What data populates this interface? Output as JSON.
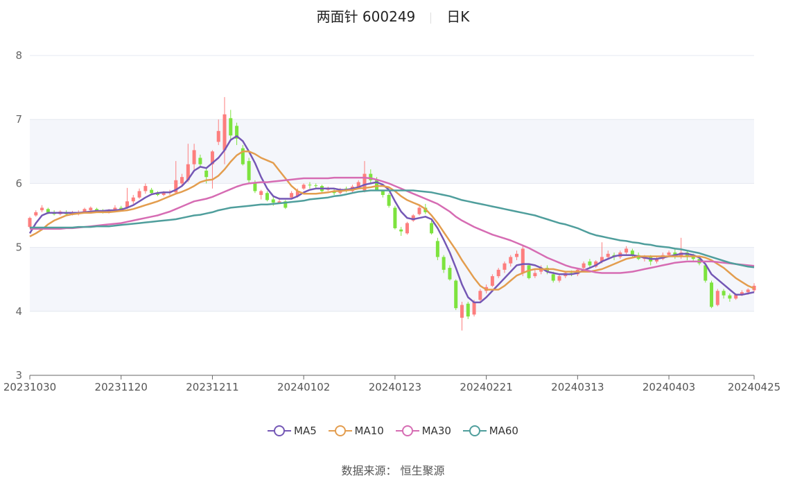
{
  "header": {
    "stock_name_code": "两面针 600249",
    "period": "日K"
  },
  "source_text": "数据来源： 恒生聚源",
  "colors": {
    "up": "#fd7e7e",
    "down": "#7de33e",
    "band": "#f4f6fb",
    "grid": "#e4e8f0",
    "MA5": "#7457b5",
    "MA10": "#e39d4e",
    "MA30": "#d66cb3",
    "MA60": "#4f9e9c"
  },
  "legend": [
    {
      "name": "MA5",
      "color": "#7457b5"
    },
    {
      "name": "MA10",
      "color": "#e39d4e"
    },
    {
      "name": "MA30",
      "color": "#d66cb3"
    },
    {
      "name": "MA60",
      "color": "#4f9e9c"
    }
  ],
  "chart_data": {
    "type": "candlestick",
    "ylim": [
      3,
      8
    ],
    "y_ticks": [
      3,
      4,
      5,
      6,
      7,
      8
    ],
    "x_tick_labels": [
      "20231030",
      "20231120",
      "20231211",
      "20240102",
      "20240123",
      "20240221",
      "20240313",
      "20240403",
      "20240425"
    ],
    "x_tick_index": [
      0,
      15,
      30,
      45,
      60,
      75,
      90,
      105,
      119
    ],
    "candles": [
      [
        5.32,
        5.46,
        5.48,
        5.3
      ],
      [
        5.5,
        5.55,
        5.58,
        5.48
      ],
      [
        5.58,
        5.62,
        5.66,
        5.55
      ],
      [
        5.6,
        5.55,
        5.62,
        5.52
      ],
      [
        5.55,
        5.52,
        5.58,
        5.5
      ],
      [
        5.52,
        5.56,
        5.58,
        5.5
      ],
      [
        5.55,
        5.52,
        5.58,
        5.5
      ],
      [
        5.52,
        5.54,
        5.57,
        5.5
      ],
      [
        5.52,
        5.55,
        5.58,
        5.5
      ],
      [
        5.55,
        5.6,
        5.62,
        5.53
      ],
      [
        5.58,
        5.62,
        5.64,
        5.55
      ],
      [
        5.6,
        5.57,
        5.62,
        5.55
      ],
      [
        5.57,
        5.55,
        5.6,
        5.53
      ],
      [
        5.55,
        5.58,
        5.6,
        5.53
      ],
      [
        5.58,
        5.62,
        5.66,
        5.56
      ],
      [
        5.62,
        5.58,
        5.65,
        5.56
      ],
      [
        5.62,
        5.72,
        5.93,
        5.6
      ],
      [
        5.72,
        5.78,
        5.82,
        5.68
      ],
      [
        5.78,
        5.88,
        5.92,
        5.76
      ],
      [
        5.88,
        5.96,
        6.0,
        5.84
      ],
      [
        5.9,
        5.85,
        5.93,
        5.82
      ],
      [
        5.85,
        5.82,
        5.88,
        5.8
      ],
      [
        5.82,
        5.85,
        5.88,
        5.8
      ],
      [
        5.85,
        5.86,
        5.9,
        5.82
      ],
      [
        5.86,
        6.05,
        6.35,
        5.84
      ],
      [
        6.0,
        6.1,
        6.15,
        5.95
      ],
      [
        6.05,
        6.3,
        6.62,
        6.02
      ],
      [
        6.3,
        6.52,
        6.62,
        6.2
      ],
      [
        6.4,
        6.3,
        6.45,
        6.25
      ],
      [
        6.2,
        6.1,
        6.25,
        6.0
      ],
      [
        6.3,
        6.5,
        6.52,
        5.92
      ],
      [
        6.65,
        6.82,
        7.0,
        6.6
      ],
      [
        6.52,
        7.08,
        7.35,
        6.3
      ],
      [
        7.02,
        6.75,
        7.15,
        6.68
      ],
      [
        6.9,
        6.7,
        6.95,
        6.6
      ],
      [
        6.55,
        6.3,
        6.6,
        6.28
      ],
      [
        6.35,
        6.05,
        6.4,
        6.0
      ],
      [
        6.0,
        5.88,
        6.05,
        5.85
      ],
      [
        5.82,
        5.88,
        5.9,
        5.75
      ],
      [
        5.85,
        5.74,
        5.88,
        5.72
      ],
      [
        5.75,
        5.7,
        5.8,
        5.65
      ],
      [
        5.7,
        5.72,
        5.78,
        5.68
      ],
      [
        5.72,
        5.62,
        5.74,
        5.6
      ],
      [
        5.78,
        5.85,
        5.88,
        5.75
      ],
      [
        5.8,
        5.88,
        5.92,
        5.78
      ],
      [
        5.92,
        5.98,
        6.0,
        5.9
      ],
      [
        5.98,
        5.97,
        6.02,
        5.92
      ],
      [
        5.97,
        5.96,
        6.0,
        5.92
      ],
      [
        5.96,
        5.88,
        5.98,
        5.85
      ],
      [
        5.9,
        5.92,
        5.95,
        5.88
      ],
      [
        5.88,
        5.85,
        5.92,
        5.82
      ],
      [
        5.85,
        5.9,
        5.93,
        5.83
      ],
      [
        5.92,
        5.88,
        5.95,
        5.86
      ],
      [
        5.88,
        5.95,
        5.98,
        5.85
      ],
      [
        5.95,
        6.02,
        6.05,
        5.92
      ],
      [
        5.88,
        6.15,
        6.35,
        5.86
      ],
      [
        6.15,
        6.05,
        6.22,
        6.0
      ],
      [
        6.05,
        5.9,
        6.1,
        5.88
      ],
      [
        5.88,
        5.82,
        5.9,
        5.78
      ],
      [
        5.82,
        5.65,
        5.85,
        5.62
      ],
      [
        5.62,
        5.3,
        5.65,
        5.28
      ],
      [
        5.28,
        5.25,
        5.32,
        5.18
      ],
      [
        5.22,
        5.38,
        5.4,
        5.2
      ],
      [
        5.42,
        5.5,
        5.52,
        5.4
      ],
      [
        5.52,
        5.62,
        5.66,
        5.5
      ],
      [
        5.62,
        5.55,
        5.68,
        5.52
      ],
      [
        5.38,
        5.22,
        5.42,
        5.2
      ],
      [
        5.1,
        4.85,
        5.15,
        4.8
      ],
      [
        4.85,
        4.65,
        4.88,
        4.6
      ],
      [
        4.68,
        4.5,
        4.72,
        4.48
      ],
      [
        4.48,
        4.05,
        4.5,
        4.02
      ],
      [
        3.9,
        4.1,
        4.15,
        3.7
      ],
      [
        4.12,
        3.92,
        4.15,
        3.88
      ],
      [
        3.95,
        4.15,
        4.18,
        3.92
      ],
      [
        4.18,
        4.32,
        4.35,
        4.15
      ],
      [
        4.32,
        4.38,
        4.42,
        4.28
      ],
      [
        4.4,
        4.55,
        4.58,
        4.38
      ],
      [
        4.55,
        4.65,
        4.68,
        4.52
      ],
      [
        4.65,
        4.75,
        4.78,
        4.6
      ],
      [
        4.75,
        4.85,
        4.88,
        4.7
      ],
      [
        4.85,
        4.9,
        4.95,
        4.8
      ],
      [
        4.6,
        4.98,
        5.02,
        4.55
      ],
      [
        4.72,
        4.52,
        4.75,
        4.5
      ],
      [
        4.55,
        4.6,
        4.65,
        4.52
      ],
      [
        4.62,
        4.68,
        4.72,
        4.58
      ],
      [
        4.68,
        4.62,
        4.72,
        4.58
      ],
      [
        4.58,
        4.48,
        4.62,
        4.45
      ],
      [
        4.48,
        4.55,
        4.58,
        4.45
      ],
      [
        4.55,
        4.6,
        4.63,
        4.52
      ],
      [
        4.6,
        4.58,
        4.64,
        4.55
      ],
      [
        4.58,
        4.65,
        4.68,
        4.55
      ],
      [
        4.68,
        4.75,
        4.78,
        4.65
      ],
      [
        4.78,
        4.72,
        4.82,
        4.68
      ],
      [
        4.7,
        4.78,
        4.8,
        4.68
      ],
      [
        4.78,
        4.85,
        5.08,
        4.75
      ],
      [
        4.85,
        4.9,
        4.95,
        4.82
      ],
      [
        4.88,
        4.85,
        4.92,
        4.8
      ],
      [
        4.85,
        4.92,
        4.95,
        4.82
      ],
      [
        4.92,
        4.98,
        5.02,
        4.88
      ],
      [
        4.95,
        4.88,
        4.98,
        4.85
      ],
      [
        4.88,
        4.82,
        4.92,
        4.8
      ],
      [
        4.82,
        4.85,
        4.88,
        4.78
      ],
      [
        4.85,
        4.78,
        4.88,
        4.72
      ],
      [
        4.78,
        4.82,
        4.85,
        4.75
      ],
      [
        4.82,
        4.88,
        4.92,
        4.8
      ],
      [
        4.88,
        4.92,
        4.95,
        4.85
      ],
      [
        4.92,
        4.85,
        4.98,
        4.82
      ],
      [
        4.85,
        4.92,
        5.15,
        4.82
      ],
      [
        4.92,
        4.85,
        4.95,
        4.8
      ],
      [
        4.85,
        4.82,
        4.9,
        4.78
      ],
      [
        4.82,
        4.75,
        4.85,
        4.72
      ],
      [
        4.72,
        4.48,
        4.75,
        4.45
      ],
      [
        4.45,
        4.07,
        4.48,
        4.05
      ],
      [
        4.1,
        4.32,
        4.35,
        4.08
      ],
      [
        4.32,
        4.25,
        4.35,
        4.2
      ],
      [
        4.25,
        4.2,
        4.28,
        4.15
      ],
      [
        4.2,
        4.26,
        4.28,
        4.18
      ],
      [
        4.26,
        4.3,
        4.33,
        4.24
      ],
      [
        4.3,
        4.34,
        4.36,
        4.26
      ],
      [
        4.33,
        4.4,
        4.44,
        4.3
      ]
    ],
    "series": [
      {
        "name": "MA5",
        "values": [
          5.22,
          5.38,
          5.5,
          5.54,
          5.54,
          5.54,
          5.54,
          5.54,
          5.54,
          5.55,
          5.56,
          5.57,
          5.57,
          5.58,
          5.58,
          5.59,
          5.62,
          5.66,
          5.72,
          5.78,
          5.83,
          5.85,
          5.86,
          5.86,
          5.9,
          5.96,
          6.06,
          6.2,
          6.26,
          6.24,
          6.32,
          6.4,
          6.52,
          6.68,
          6.74,
          6.66,
          6.5,
          6.32,
          6.1,
          5.92,
          5.8,
          5.76,
          5.76,
          5.76,
          5.8,
          5.86,
          5.9,
          5.92,
          5.92,
          5.92,
          5.92,
          5.9,
          5.9,
          5.92,
          5.94,
          5.98,
          6.0,
          6.02,
          5.98,
          5.9,
          5.72,
          5.56,
          5.46,
          5.44,
          5.46,
          5.48,
          5.44,
          5.3,
          5.12,
          4.92,
          4.68,
          4.42,
          4.22,
          4.14,
          4.14,
          4.22,
          4.32,
          4.42,
          4.52,
          4.62,
          4.72,
          4.74,
          4.74,
          4.72,
          4.68,
          4.62,
          4.6,
          4.58,
          4.58,
          4.58,
          4.6,
          4.64,
          4.68,
          4.72,
          4.78,
          4.82,
          4.86,
          4.88,
          4.88,
          4.88,
          4.86,
          4.84,
          4.82,
          4.82,
          4.84,
          4.86,
          4.88,
          4.9,
          4.9,
          4.88,
          4.84,
          4.74,
          4.58,
          4.5,
          4.42,
          4.34,
          4.26,
          4.26,
          4.28,
          4.3
        ]
      },
      {
        "name": "MA10",
        "values": [
          5.17,
          5.22,
          5.28,
          5.36,
          5.42,
          5.46,
          5.5,
          5.52,
          5.53,
          5.54,
          5.54,
          5.55,
          5.55,
          5.55,
          5.56,
          5.57,
          5.58,
          5.6,
          5.63,
          5.66,
          5.69,
          5.72,
          5.76,
          5.8,
          5.84,
          5.87,
          5.91,
          5.96,
          6.02,
          6.05,
          6.06,
          6.12,
          6.22,
          6.34,
          6.44,
          6.5,
          6.5,
          6.46,
          6.4,
          6.36,
          6.32,
          6.2,
          6.08,
          5.96,
          5.88,
          5.84,
          5.84,
          5.84,
          5.85,
          5.86,
          5.88,
          5.88,
          5.89,
          5.9,
          5.92,
          5.93,
          5.94,
          5.96,
          5.96,
          5.94,
          5.88,
          5.8,
          5.74,
          5.7,
          5.66,
          5.6,
          5.5,
          5.38,
          5.24,
          5.1,
          4.96,
          4.8,
          4.66,
          4.52,
          4.4,
          4.34,
          4.34,
          4.34,
          4.4,
          4.48,
          4.56,
          4.6,
          4.64,
          4.66,
          4.66,
          4.66,
          4.66,
          4.64,
          4.62,
          4.62,
          4.62,
          4.62,
          4.62,
          4.64,
          4.66,
          4.7,
          4.74,
          4.78,
          4.82,
          4.84,
          4.86,
          4.86,
          4.86,
          4.86,
          4.86,
          4.86,
          4.86,
          4.86,
          4.86,
          4.86,
          4.86,
          4.84,
          4.8,
          4.74,
          4.68,
          4.6,
          4.52,
          4.46,
          4.4,
          4.36
        ]
      },
      {
        "name": "MA30",
        "values": [
          5.29,
          5.29,
          5.29,
          5.29,
          5.29,
          5.29,
          5.3,
          5.3,
          5.31,
          5.32,
          5.33,
          5.34,
          5.35,
          5.36,
          5.37,
          5.38,
          5.4,
          5.42,
          5.44,
          5.46,
          5.48,
          5.5,
          5.53,
          5.56,
          5.6,
          5.64,
          5.68,
          5.72,
          5.74,
          5.76,
          5.79,
          5.83,
          5.87,
          5.91,
          5.95,
          5.98,
          6.0,
          6.01,
          6.02,
          6.02,
          6.03,
          6.04,
          6.05,
          6.06,
          6.07,
          6.08,
          6.08,
          6.08,
          6.08,
          6.08,
          6.09,
          6.09,
          6.09,
          6.09,
          6.09,
          6.09,
          6.08,
          6.06,
          6.03,
          6.0,
          5.96,
          5.92,
          5.88,
          5.84,
          5.8,
          5.76,
          5.72,
          5.68,
          5.62,
          5.56,
          5.48,
          5.42,
          5.37,
          5.32,
          5.28,
          5.24,
          5.2,
          5.17,
          5.14,
          5.11,
          5.07,
          5.03,
          4.99,
          4.94,
          4.89,
          4.84,
          4.8,
          4.76,
          4.72,
          4.69,
          4.67,
          4.65,
          4.63,
          4.61,
          4.6,
          4.6,
          4.6,
          4.6,
          4.61,
          4.62,
          4.64,
          4.66,
          4.68,
          4.7,
          4.72,
          4.74,
          4.76,
          4.77,
          4.78,
          4.78,
          4.78,
          4.78,
          4.78,
          4.77,
          4.76,
          4.75,
          4.74,
          4.73,
          4.72,
          4.71
        ]
      },
      {
        "name": "MA60",
        "values": [
          5.31,
          5.31,
          5.31,
          5.31,
          5.31,
          5.31,
          5.31,
          5.31,
          5.32,
          5.32,
          5.32,
          5.33,
          5.33,
          5.33,
          5.34,
          5.35,
          5.36,
          5.37,
          5.38,
          5.39,
          5.4,
          5.41,
          5.42,
          5.43,
          5.44,
          5.46,
          5.48,
          5.5,
          5.51,
          5.53,
          5.55,
          5.58,
          5.6,
          5.62,
          5.63,
          5.64,
          5.65,
          5.66,
          5.67,
          5.67,
          5.68,
          5.69,
          5.7,
          5.71,
          5.72,
          5.73,
          5.75,
          5.76,
          5.77,
          5.78,
          5.8,
          5.81,
          5.83,
          5.85,
          5.87,
          5.88,
          5.89,
          5.89,
          5.89,
          5.89,
          5.89,
          5.89,
          5.89,
          5.89,
          5.88,
          5.87,
          5.86,
          5.84,
          5.82,
          5.8,
          5.77,
          5.74,
          5.72,
          5.7,
          5.68,
          5.66,
          5.64,
          5.62,
          5.6,
          5.58,
          5.56,
          5.54,
          5.52,
          5.5,
          5.47,
          5.44,
          5.41,
          5.38,
          5.36,
          5.33,
          5.3,
          5.26,
          5.22,
          5.19,
          5.17,
          5.15,
          5.13,
          5.11,
          5.1,
          5.08,
          5.07,
          5.05,
          5.04,
          5.02,
          5.01,
          5.0,
          4.98,
          4.97,
          4.95,
          4.93,
          4.91,
          4.88,
          4.85,
          4.82,
          4.79,
          4.76,
          4.74,
          4.72,
          4.7,
          4.69
        ]
      }
    ]
  }
}
